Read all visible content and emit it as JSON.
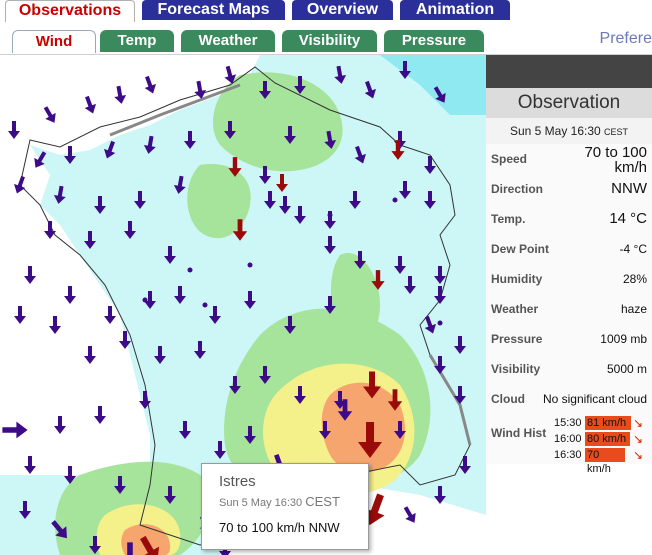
{
  "top_tabs": [
    "Observations",
    "Forecast Maps",
    "Overview",
    "Animation"
  ],
  "sub_tabs": [
    "Wind",
    "Temp",
    "Weather",
    "Visibility",
    "Pressure"
  ],
  "prefs_label": "Prefere",
  "panel": {
    "title": "Observation",
    "datetime": "Sun 5 May 16:30",
    "tz": "CEST",
    "rows": [
      {
        "label": "Speed",
        "value": "70 to 100 km/h"
      },
      {
        "label": "Direction",
        "value": "NNW"
      },
      {
        "label": "Temp.",
        "value": "14 °C"
      },
      {
        "label": "Dew Point",
        "value": "-4 °C"
      },
      {
        "label": "Humidity",
        "value": "28%"
      },
      {
        "label": "Weather",
        "value": "haze"
      },
      {
        "label": "Pressure",
        "value": "1009 mb"
      },
      {
        "label": "Visibility",
        "value": "5000 m"
      },
      {
        "label": "Cloud",
        "value": "No significant cloud"
      }
    ],
    "wind_hist_label": "Wind Hist",
    "wind_hist": [
      {
        "time": "15:30",
        "value": "81 km/h",
        "fill": 0.81
      },
      {
        "time": "16:00",
        "value": "80 km/h",
        "fill": 0.8
      },
      {
        "time": "16:30",
        "value": "70 km/h",
        "fill": 0.7
      }
    ]
  },
  "tooltip": {
    "station": "Istres",
    "datetime": "Sun 5 May 16:30",
    "tz": "CEST",
    "wind": "70 to 100 km/h NNW"
  },
  "colors": {
    "tab_blue": "#2b2f9a",
    "tab_green": "#3a8a5e",
    "active_red": "#cc0000",
    "map_light_blue": "#cdf6f6",
    "map_green": "#a6e39b",
    "map_yellow": "#f4f08a",
    "map_orange": "#f7a56e",
    "arrow_purple": "#3d0b87",
    "arrow_red": "#9b0a0a",
    "hist_bar": "#e84c1c"
  },
  "icons": {
    "wind_arrow": "arrow-down",
    "hist_arrow": "arrow-down-red"
  }
}
